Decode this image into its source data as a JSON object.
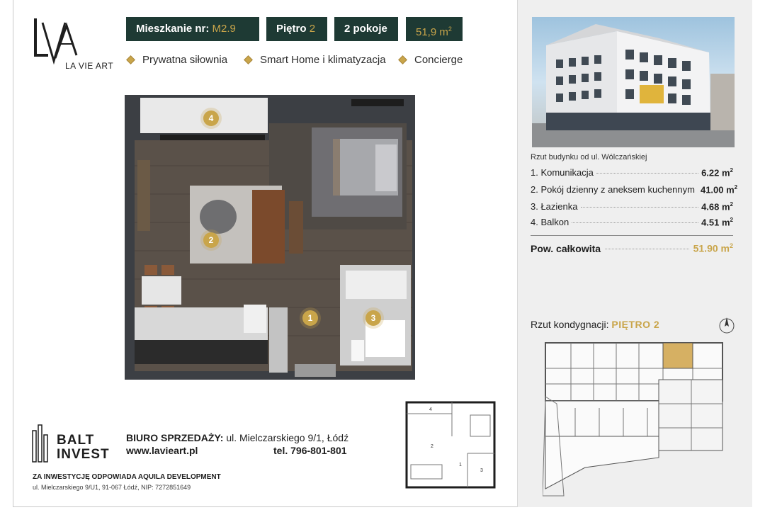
{
  "brand": {
    "logo_text": "LA VIE ART"
  },
  "header": {
    "apartment_label": "Mieszkanie nr:",
    "apartment_value": "M2.9",
    "floor_label": "Piętro",
    "floor_value": "2",
    "rooms": "2 pokoje",
    "area_value": "51,9 m",
    "area_sup": "2"
  },
  "features": [
    {
      "label": "Prywatna siłownia"
    },
    {
      "label": "Smart Home i klimatyzacja"
    },
    {
      "label": "Concierge"
    }
  ],
  "plan_markers": [
    "4",
    "2",
    "1",
    "3"
  ],
  "building_caption": "Rzut budynku od ul. Wólczańskiej",
  "rooms_table": [
    {
      "name": "1. Komunikacja",
      "area": "6.22 m",
      "sup": "2"
    },
    {
      "name": "2. Pokój dzienny z aneksem kuchennym",
      "area": "41.00 m",
      "sup": "2"
    },
    {
      "name": "3. Łazienka",
      "area": "4.68 m",
      "sup": "2"
    },
    {
      "name": "4. Balkon",
      "area": "4.51 m",
      "sup": "2"
    }
  ],
  "total": {
    "label": "Pow. całkowita",
    "area": "51.90 m",
    "sup": "2"
  },
  "floor_section": {
    "label": "Rzut kondygnacji:",
    "value": "PIĘTRO 2"
  },
  "footer": {
    "developer_line1": "BALT",
    "developer_line2": "INVEST",
    "sales_label": "BIURO SPRZEDAŻY:",
    "sales_address": "ul. Mielczarskiego 9/1, Łódź",
    "website": "www.lavieart.pl",
    "phone": "tel. 796-801-801",
    "investor": "ZA INWESTYCJĘ ODPOWIADA AQUILA DEVELOPMENT",
    "investor_address": "ul. Mielczarskiego 9/U1, 91-067 Łódź, NIP: 7272851649"
  },
  "colors": {
    "brand_green": "#1e3a34",
    "gold": "#c9a54a"
  }
}
